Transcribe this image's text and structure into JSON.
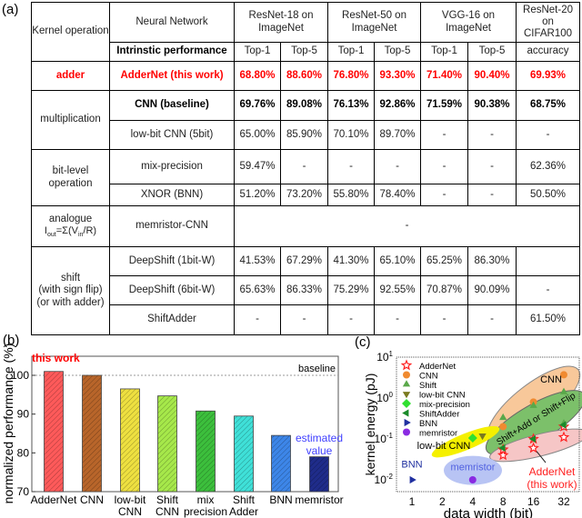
{
  "panel_labels": {
    "a": "(a)",
    "b": "(b)",
    "c": "(c)"
  },
  "table": {
    "header": {
      "kernel": "Kernel operation",
      "network": "Neural Network",
      "intrinsic": "Intrinstic performance",
      "datasets": [
        "ResNet-18 on ImageNet",
        "ResNet-50 on ImageNet",
        "VGG-16 on ImageNet",
        "ResNet-20 on CIFAR100"
      ],
      "metrics": [
        "Top-1",
        "Top-5",
        "Top-1",
        "Top-5",
        "Top-1",
        "Top-5",
        "accuracy"
      ]
    },
    "groups": [
      {
        "kernel": "adder",
        "rows": [
          {
            "network": "AdderNet (this work)",
            "values": [
              "68.80%",
              "88.60%",
              "76.80%",
              "93.30%",
              "71.40%",
              "90.40%",
              "69.93%"
            ],
            "style": "red"
          }
        ]
      },
      {
        "kernel": "multiplication",
        "rows": [
          {
            "network": "CNN (baseline)",
            "values": [
              "69.76%",
              "89.08%",
              "76.13%",
              "92.86%",
              "71.59%",
              "90.38%",
              "68.75%"
            ],
            "style": "bold"
          },
          {
            "network": "low-bit CNN (5bit)",
            "values": [
              "65.00%",
              "85.90%",
              "70.10%",
              "89.70%",
              "-",
              "-",
              "-"
            ]
          }
        ]
      },
      {
        "kernel": "bit-level operation",
        "rows": [
          {
            "network": "mix-precision",
            "values": [
              "59.47%",
              "-",
              "-",
              "-",
              "-",
              "-",
              "62.36%"
            ]
          },
          {
            "network": "XNOR (BNN)",
            "values": [
              "51.20%",
              "73.20%",
              "55.80%",
              "78.40%",
              "-",
              "-",
              "50.50%"
            ]
          }
        ]
      },
      {
        "kernel": "analogue",
        "kernel_formula": "Iout=Σ(Vin/R)",
        "rows": [
          {
            "network": "memristor-CNN",
            "merged": "-"
          }
        ]
      },
      {
        "kernel": "shift (with sign flip) (or with adder)",
        "rows": [
          {
            "network": "DeepShift (1bit-W)",
            "values": [
              "41.53%",
              "67.29%",
              "41.30%",
              "65.10%",
              "65.25%",
              "86.30%",
              ""
            ]
          },
          {
            "network": "DeepShift (6bit-W)",
            "values": [
              "65.63%",
              "86.33%",
              "75.29%",
              "92.55%",
              "70.87%",
              "90.09%",
              "-"
            ]
          },
          {
            "network": "ShiftAdder",
            "values": [
              "-",
              "-",
              "-",
              "-",
              "-",
              "-",
              "61.50%"
            ]
          }
        ]
      }
    ]
  },
  "chart_data": [
    {
      "type": "bar",
      "ylabel": "normalized performance (%)",
      "ylim": [
        70,
        105
      ],
      "yticks": [
        70,
        80,
        90,
        100
      ],
      "categories": [
        "AdderNet",
        "CNN",
        "low-bit CNN",
        "Shift CNN",
        "mix precision",
        "Shift Adder",
        "BNN",
        "memristor"
      ],
      "values": [
        101,
        100,
        96.5,
        94.7,
        90.8,
        89.5,
        84.5,
        79
      ],
      "colors": [
        "#ff5a5a",
        "#b8652a",
        "#eee040",
        "#a6e84a",
        "#3cbf3c",
        "#3fe0d8",
        "#3d86e8",
        "#1f2c8a"
      ],
      "annotations": {
        "this_work": "this work",
        "baseline": "baseline",
        "estimated": "estimated value"
      },
      "baseline_value": 100,
      "grid": false
    },
    {
      "type": "scatter",
      "xlabel": "data width (bit)",
      "ylabel": "kernel energy (pJ)",
      "xscale": "log2",
      "yscale": "log",
      "xticks": [
        1,
        2,
        4,
        8,
        16,
        32
      ],
      "yticks": [
        "10^-2",
        "10^-1",
        "10^0",
        "10^1"
      ],
      "ylim": [
        0.005,
        10
      ],
      "legend_position": "top-left",
      "series": [
        {
          "name": "AdderNet",
          "marker": "star",
          "color": "#ff2020",
          "points": [
            [
              8,
              0.04
            ],
            [
              8,
              0.055
            ],
            [
              16,
              0.06
            ],
            [
              16,
              0.1
            ],
            [
              32,
              0.11
            ],
            [
              32,
              0.2
            ]
          ]
        },
        {
          "name": "CNN",
          "marker": "circle",
          "color": "#f08a30",
          "points": [
            [
              8,
              0.2
            ],
            [
              16,
              0.8
            ],
            [
              32,
              3.7
            ]
          ]
        },
        {
          "name": "Shift",
          "marker": "triangle-up",
          "color": "#5aa84a",
          "points": [
            [
              8,
              0.33
            ],
            [
              16,
              0.65
            ],
            [
              32,
              1.4
            ],
            [
              32,
              0.24
            ]
          ]
        },
        {
          "name": "low-bit CNN",
          "marker": "triangle-down",
          "color": "#7a7a20",
          "points": [
            [
              5,
              0.12
            ]
          ]
        },
        {
          "name": "mix-precision",
          "marker": "diamond",
          "color": "#30e030",
          "points": [
            [
              4,
              0.105
            ]
          ]
        },
        {
          "name": "ShiftAdder",
          "marker": "triangle-left",
          "color": "#1a8a2a",
          "points": [
            [
              8,
              0.06
            ],
            [
              16,
              0.1
            ],
            [
              32,
              0.22
            ]
          ]
        },
        {
          "name": "BNN",
          "marker": "triangle-right",
          "color": "#2030a0",
          "points": [
            [
              1,
              0.01
            ]
          ]
        },
        {
          "name": "memristor",
          "marker": "hexagon",
          "color": "#8a2be2",
          "points": [
            [
              4,
              0.01
            ]
          ]
        }
      ],
      "region_labels": {
        "cnn": "CNN",
        "shift": "Shift+Add or Shift+Flip",
        "lowbit": "low-bit CNN",
        "memristor": "memristor",
        "bnn": "BNN",
        "addernet": "AdderNet",
        "addernet_note": "(this work)"
      }
    }
  ]
}
